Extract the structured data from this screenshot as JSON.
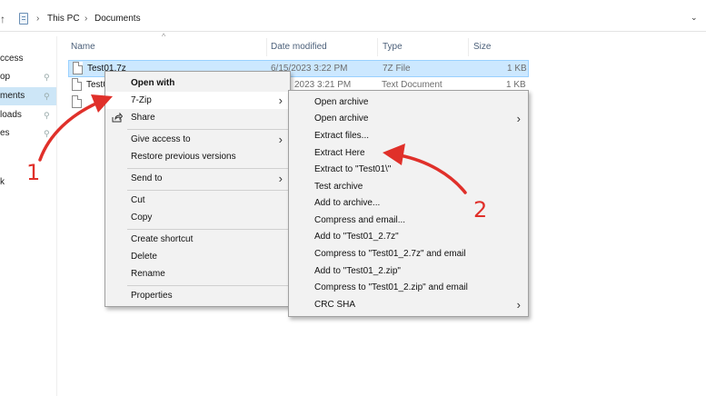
{
  "address_bar": {
    "up_icon": "arrow-up-icon",
    "location_icon": "this-pc-icon",
    "crumbs": [
      "This PC",
      "Documents"
    ],
    "separator": "›",
    "dropdown": "⌄"
  },
  "nav": {
    "items": [
      {
        "label": "ccess",
        "pinned": false,
        "selected": false
      },
      {
        "label": "op",
        "pinned": true,
        "selected": false
      },
      {
        "label": "ments",
        "pinned": true,
        "selected": true
      },
      {
        "label": "loads",
        "pinned": true,
        "selected": false
      },
      {
        "label": "es",
        "pinned": true,
        "selected": false
      },
      {
        "label": "k",
        "pinned": false,
        "selected": false
      }
    ]
  },
  "file_list": {
    "sort_caret": "^",
    "columns": [
      "Name",
      "Date modified",
      "Type",
      "Size"
    ],
    "rows": [
      {
        "name": "Test01.7z",
        "date": "6/15/2023 3:22 PM",
        "type": "7Z File",
        "size": "1 KB",
        "selected": true
      },
      {
        "name": "Test0",
        "date": "2023 3:21 PM",
        "type": "Text Document",
        "size": "1 KB",
        "selected": false
      },
      {
        "name": "",
        "date": "",
        "type": "",
        "size": "",
        "selected": false
      }
    ]
  },
  "context_menu": {
    "items": [
      {
        "label": "Open with",
        "bold": true
      },
      {
        "label": "7-Zip",
        "submenu": true,
        "highlighted": true
      },
      {
        "label": "Share",
        "icon": "share-icon"
      },
      {
        "label": "Give access to",
        "submenu": true
      },
      {
        "label": "Restore previous versions"
      },
      {
        "label": "Send to",
        "submenu": true
      },
      {
        "label": "Cut"
      },
      {
        "label": "Copy"
      },
      {
        "label": "Create shortcut"
      },
      {
        "label": "Delete"
      },
      {
        "label": "Rename"
      },
      {
        "label": "Properties"
      }
    ]
  },
  "zip_submenu": {
    "items": [
      {
        "label": "Open archive"
      },
      {
        "label": "Open archive",
        "submenu": true
      },
      {
        "label": "Extract files..."
      },
      {
        "label": "Extract Here"
      },
      {
        "label": "Extract to \"Test01\\\""
      },
      {
        "label": "Test archive"
      },
      {
        "label": "Add to archive..."
      },
      {
        "label": "Compress and email..."
      },
      {
        "label": "Add to \"Test01_2.7z\""
      },
      {
        "label": "Compress to \"Test01_2.7z\" and email"
      },
      {
        "label": "Add to \"Test01_2.zip\""
      },
      {
        "label": "Compress to \"Test01_2.zip\" and email"
      },
      {
        "label": "CRC SHA",
        "submenu": true
      }
    ]
  },
  "annotations": {
    "step1": "1",
    "step2": "2",
    "color": "#e0302a"
  },
  "colors": {
    "selection": "#cce8ff",
    "nav_selection": "#cde6f7",
    "menu_bg": "#f2f2f2"
  }
}
